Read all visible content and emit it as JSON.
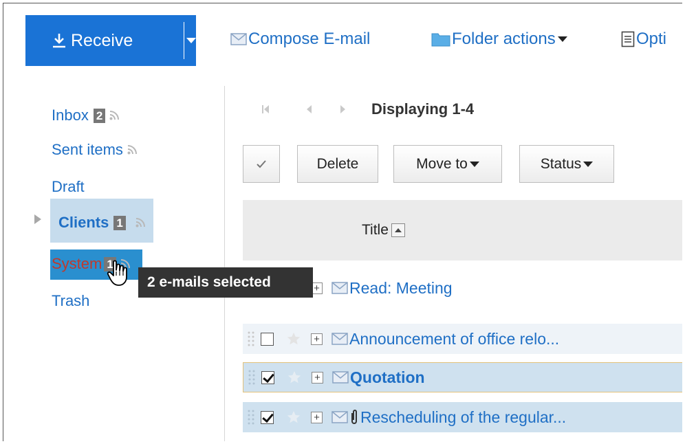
{
  "toolbar": {
    "receive_label": "Receive",
    "compose_label": "Compose E-mail",
    "folder_actions_label": "Folder actions",
    "options_label": "Opti"
  },
  "sidebar": {
    "items": [
      {
        "label": "Inbox",
        "badge": "2"
      },
      {
        "label": "Sent items"
      },
      {
        "label": "Draft"
      },
      {
        "label": "Clients",
        "badge": "1"
      },
      {
        "label": "System",
        "badge": "1"
      },
      {
        "label": "Trash"
      }
    ]
  },
  "drag_tooltip": "2 e-mails selected",
  "pager": {
    "label": "Displaying 1-4"
  },
  "actions": {
    "delete_label": "Delete",
    "move_label": "Move to",
    "status_label": "Status"
  },
  "list": {
    "title_header": "Title",
    "rows": [
      {
        "subject": "Read: Meeting",
        "checked": false,
        "bold": false,
        "attachment": false
      },
      {
        "subject": "Announcement of office relo...",
        "checked": false,
        "bold": false,
        "attachment": false
      },
      {
        "subject": "Quotation",
        "checked": true,
        "bold": true,
        "attachment": false
      },
      {
        "subject": "Rescheduling of the regular...",
        "checked": true,
        "bold": false,
        "attachment": true
      }
    ]
  },
  "colors": {
    "accent": "#1a73d6",
    "link": "#1f6fc5",
    "selected_row": "#cfe1ef",
    "folder_highlight": "#2a8fcf"
  }
}
